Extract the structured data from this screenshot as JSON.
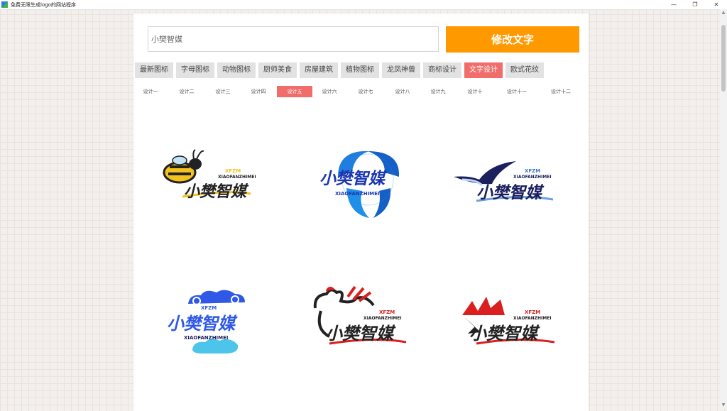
{
  "window": {
    "title": "免费无限生成logo的网站程序",
    "controls": {
      "minimize": "—",
      "maximize": "❐",
      "close": "✕"
    }
  },
  "search": {
    "value": "小樊智媒",
    "button_label": "修改文字"
  },
  "categories": [
    {
      "label": "最新图标"
    },
    {
      "label": "字母图标"
    },
    {
      "label": "动物图标"
    },
    {
      "label": "厨师美食"
    },
    {
      "label": "房屋建筑"
    },
    {
      "label": "植物图标"
    },
    {
      "label": "龙凤神兽"
    },
    {
      "label": "商标设计"
    },
    {
      "label": "文字设计"
    },
    {
      "label": "欧式花纹"
    }
  ],
  "active_category": "文字设计",
  "designs": [
    {
      "label": "设计一"
    },
    {
      "label": "设计二"
    },
    {
      "label": "设计三"
    },
    {
      "label": "设计四"
    },
    {
      "label": "设计五"
    },
    {
      "label": "设计六"
    },
    {
      "label": "设计七"
    },
    {
      "label": "设计八"
    },
    {
      "label": "设计九"
    },
    {
      "label": "设计十"
    },
    {
      "label": "设计十一"
    },
    {
      "label": "设计十二"
    }
  ],
  "active_design": "设计五",
  "logos": [
    {
      "text": "小樊智媒",
      "pinyin": "XIAOFANZHIMEI",
      "abbr": "XFZM",
      "icon": "bee-icon"
    },
    {
      "text": "小樊智媒",
      "pinyin": "XIAOFANZHIMEI",
      "abbr": "",
      "icon": "dolphin-icon"
    },
    {
      "text": "小樊智媒",
      "pinyin": "XIAOFANZHIMEI",
      "abbr": "XFZM",
      "icon": "bird-icon"
    },
    {
      "text": "小樊智媒",
      "pinyin": "XIAOFANZHIMEI",
      "abbr": "XFZM",
      "icon": "cloud-icon"
    },
    {
      "text": "小樊智媒",
      "pinyin": "XIAOFANZHIMEI",
      "abbr": "XFZM",
      "icon": "rooster-icon"
    },
    {
      "text": "小樊智媒",
      "pinyin": "XIAOFANZHIMEI",
      "abbr": "XFZM",
      "icon": "ribbon-icon"
    }
  ],
  "colors": {
    "accent": "#ff9900",
    "active_tab": "#f06d6b",
    "dark_navy": "#1b1f5e",
    "blue": "#1f8fe8"
  }
}
